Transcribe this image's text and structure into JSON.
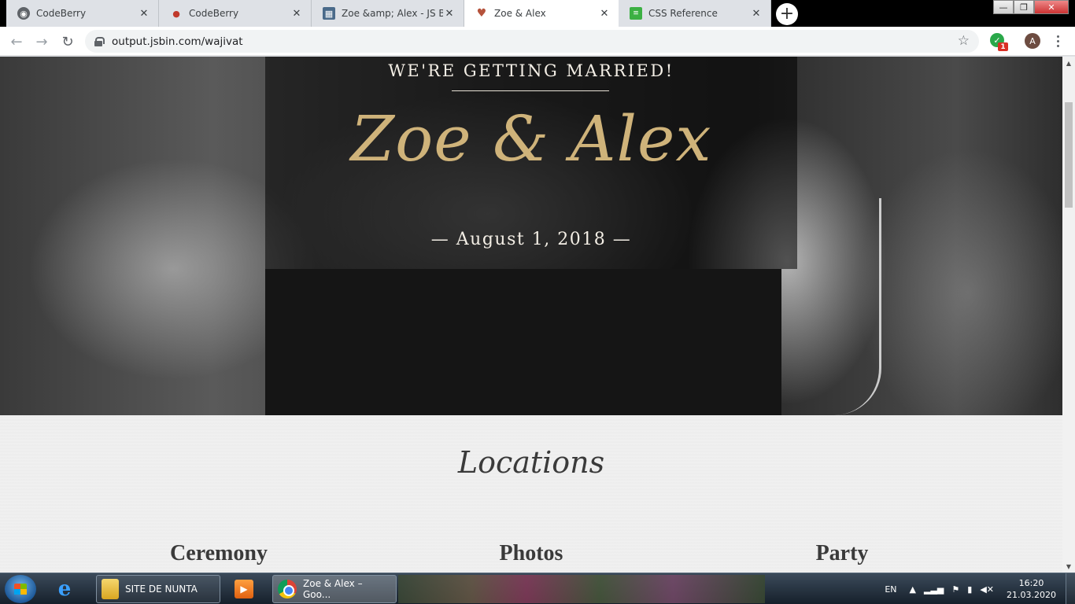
{
  "browser": {
    "tabs": [
      {
        "title": "CodeBerry",
        "favicon": "codeberry-icon",
        "active": false
      },
      {
        "title": "CodeBerry",
        "favicon": "codeberry-berry-icon",
        "active": false
      },
      {
        "title": "Zoe &amp; Alex - JS Bin",
        "favicon": "jsbin-icon",
        "active": false
      },
      {
        "title": "Zoe & Alex",
        "favicon": "heart-icon",
        "active": true
      },
      {
        "title": "CSS Reference",
        "favicon": "css-reference-icon",
        "active": false
      }
    ],
    "close_glyph": "✕",
    "new_tab_glyph": "+",
    "url": "output.jsbin.com/wajivat",
    "extension_badge": "1",
    "profile_initial": "A",
    "window_controls": {
      "minimize": "—",
      "maximize": "❐",
      "close": "✕"
    }
  },
  "page": {
    "hero": {
      "kicker": "WE'RE GETTING MARRIED!",
      "names": "Zoe & Alex",
      "date": "— August 1, 2018 —"
    },
    "locations": {
      "title": "Locations",
      "columns": [
        "Ceremony",
        "Photos",
        "Party"
      ]
    }
  },
  "taskbar": {
    "items": [
      {
        "label": "",
        "icon": "internet-explorer-icon"
      },
      {
        "label": "SITE DE NUNTA",
        "icon": "folder-icon"
      },
      {
        "label": "",
        "icon": "media-player-icon"
      },
      {
        "label": "Zoe & Alex – Goo...",
        "icon": "chrome-icon"
      }
    ],
    "language": "EN",
    "time": "16:20",
    "date": "21.03.2020"
  }
}
